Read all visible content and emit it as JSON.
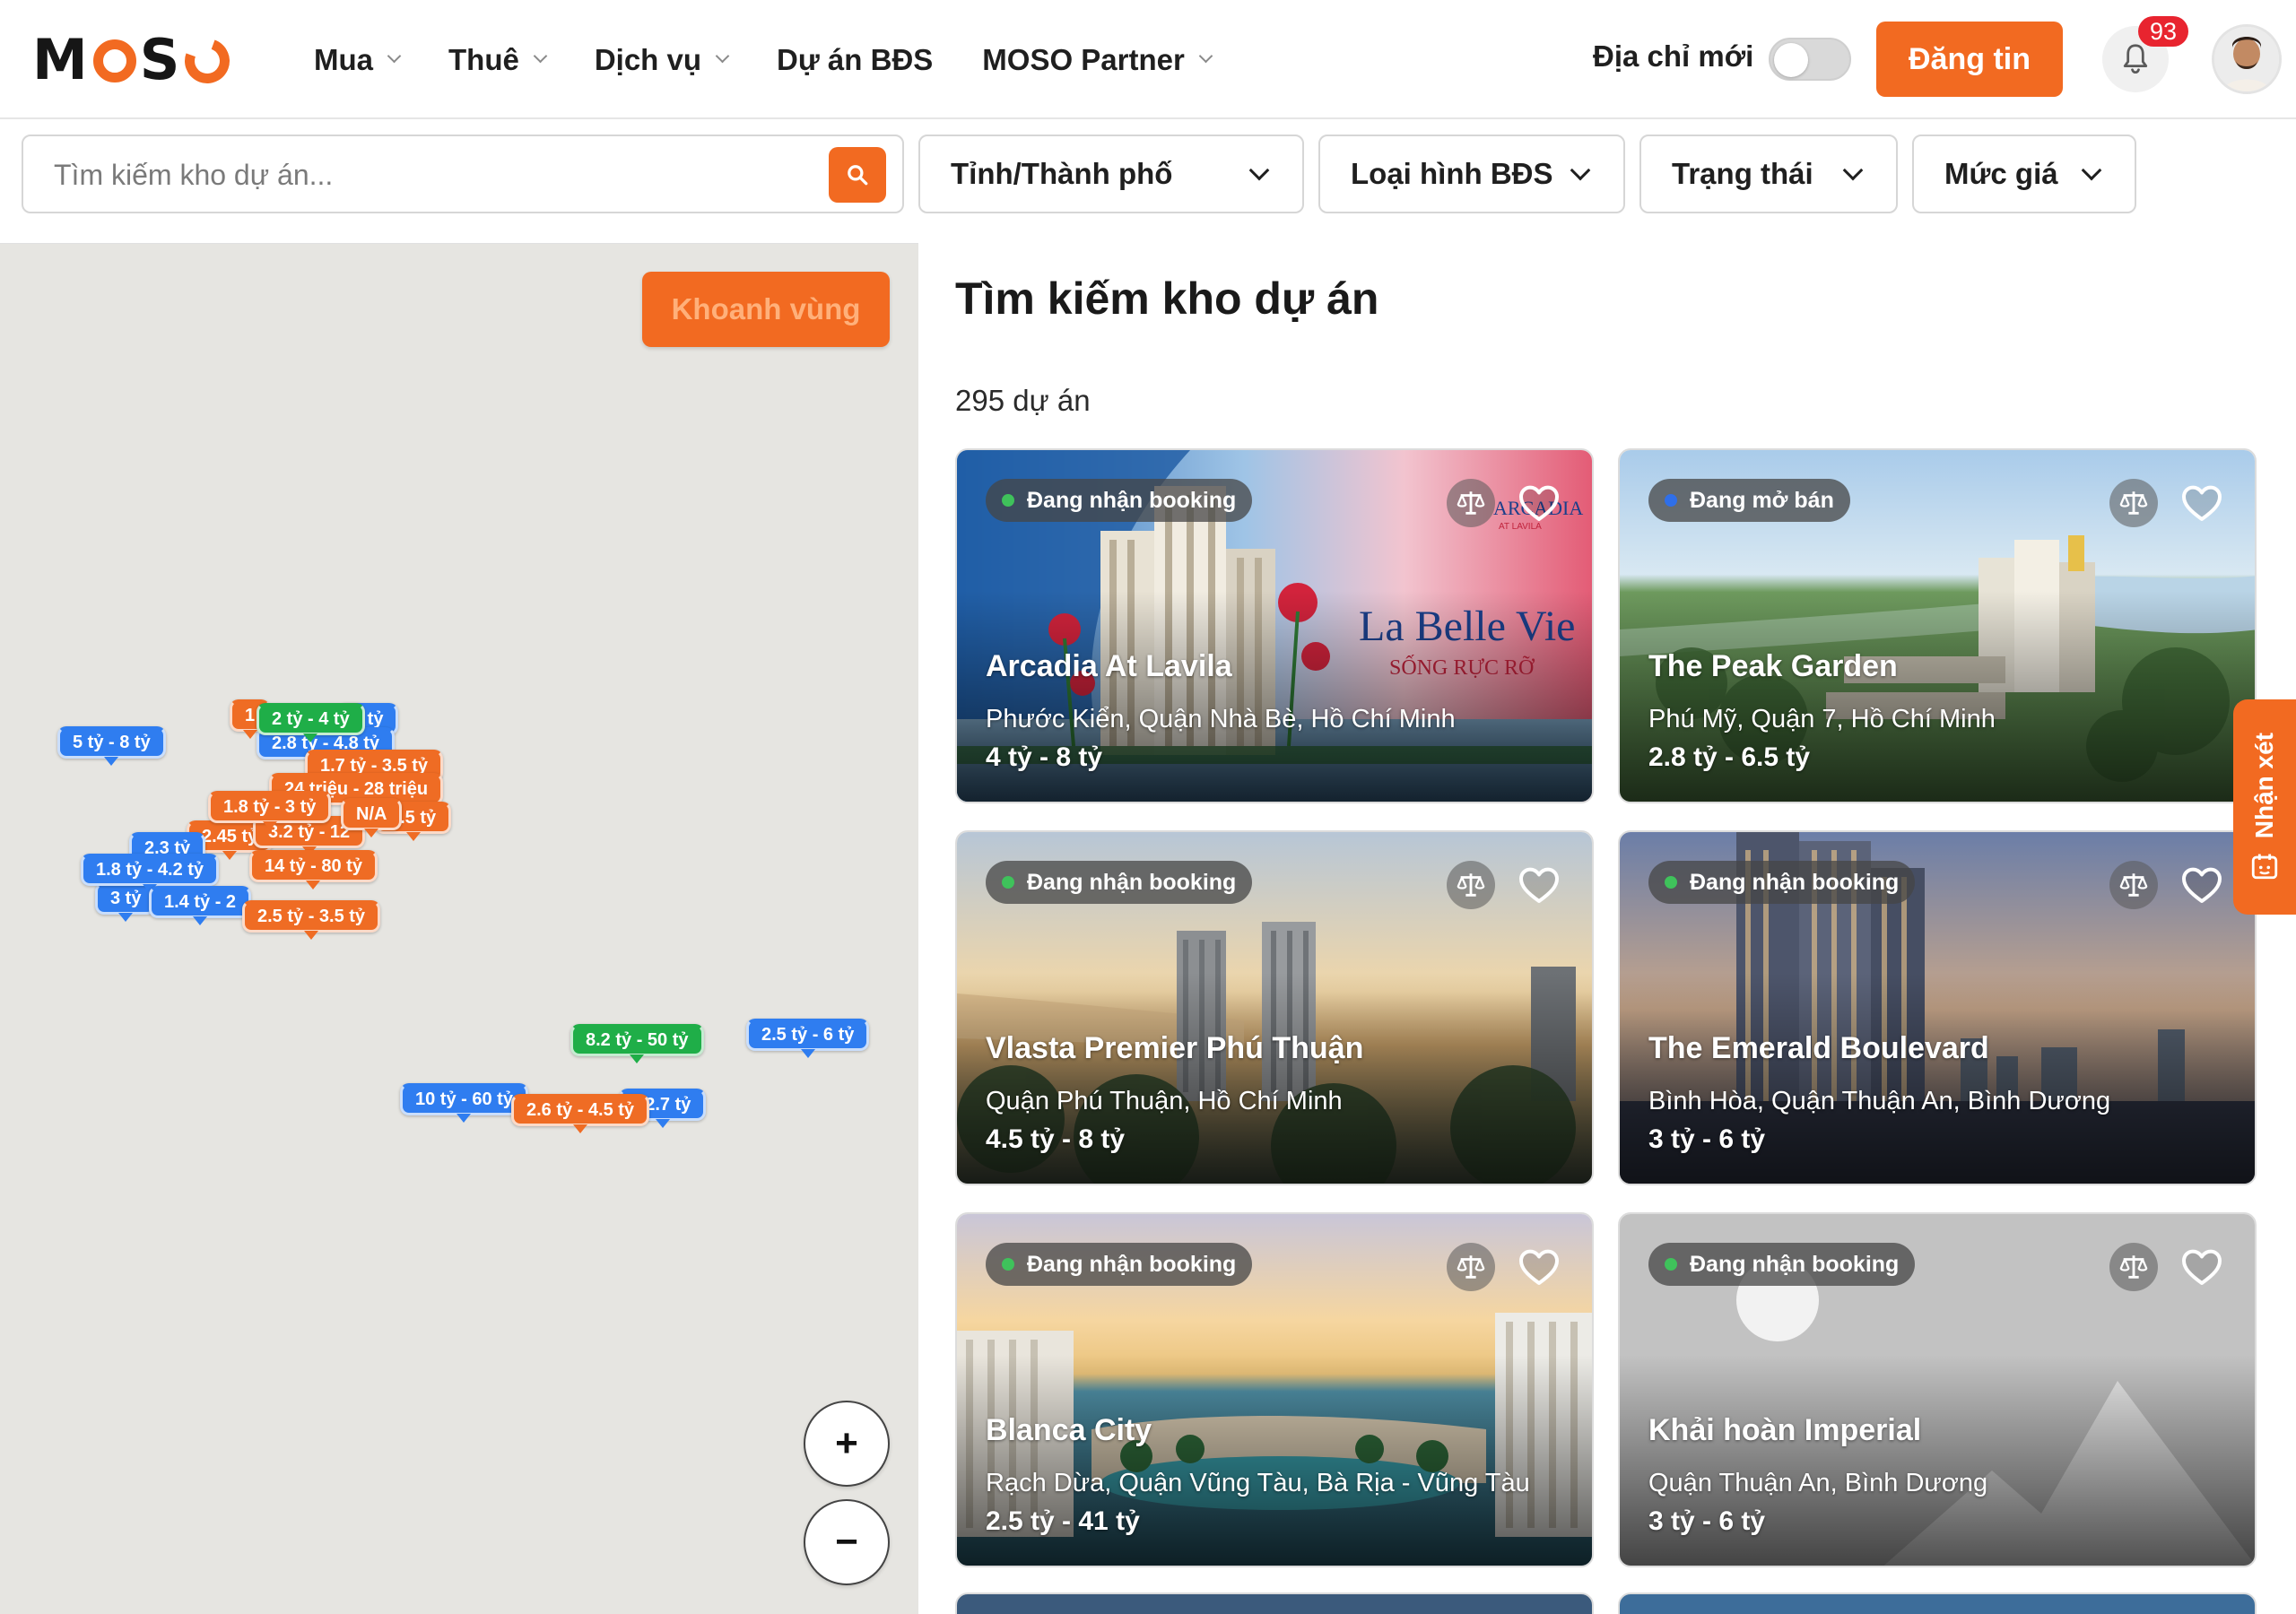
{
  "header": {
    "logo": "MOSO",
    "nav": [
      {
        "label": "Mua",
        "dropdown": true
      },
      {
        "label": "Thuê",
        "dropdown": true
      },
      {
        "label": "Dịch vụ",
        "dropdown": true
      },
      {
        "label": "Dự án BĐS",
        "dropdown": false
      },
      {
        "label": "MOSO Partner",
        "dropdown": true
      }
    ],
    "address_toggle_label": "Địa chỉ mới",
    "address_toggle_on": false,
    "post_button": "Đăng tin",
    "notification_count": "93",
    "accent_color": "#f26a21"
  },
  "filters": {
    "search_placeholder": "Tìm kiếm kho dự án...",
    "province": "Tỉnh/Thành phố",
    "property_type": "Loại hình BĐS",
    "status": "Trạng thái",
    "price": "Mức giá"
  },
  "map": {
    "zone_button": "Khoanh vùng",
    "zoom_in": "+",
    "zoom_out": "−",
    "pins": [
      {
        "label": "5 tỷ - 8 tỷ",
        "color": "blue"
      },
      {
        "label": "1",
        "color": "orange"
      },
      {
        "label": "2 tỷ - 4 tỷ",
        "color": "green"
      },
      {
        "label": "5 tỷ",
        "color": "blue"
      },
      {
        "label": "2.8 tỷ - 4.8 tỷ",
        "color": "blue"
      },
      {
        "label": "1.7 tỷ - 3.5 tỷ",
        "color": "orange"
      },
      {
        "label": "24 triệu - 28 triệu",
        "color": "orange"
      },
      {
        "label": "1.8 tỷ - 3 tỷ",
        "color": "orange"
      },
      {
        "label": "N/A",
        "color": "orange"
      },
      {
        "label": "5.5 tỷ",
        "color": "orange"
      },
      {
        "label": "3.2 tỷ - 12",
        "color": "orange"
      },
      {
        "label": "2.45 tỷ",
        "color": "orange"
      },
      {
        "label": "2.3 tỷ",
        "color": "blue"
      },
      {
        "label": "14 tỷ - 80 tỷ",
        "color": "orange"
      },
      {
        "label": "1.8 tỷ - 4.2 tỷ",
        "color": "blue"
      },
      {
        "label": "3 tỷ",
        "color": "blue"
      },
      {
        "label": "1.4 tỷ - 2",
        "color": "blue"
      },
      {
        "label": "2.5 tỷ - 3.5 tỷ",
        "color": "orange"
      },
      {
        "label": "8.2 tỷ - 50 tỷ",
        "color": "green"
      },
      {
        "label": "2.5 tỷ - 6 tỷ",
        "color": "blue"
      },
      {
        "label": "10 tỷ - 60 tỷ",
        "color": "blue"
      },
      {
        "label": "- 2.7 tỷ",
        "color": "blue"
      },
      {
        "label": "2.6 tỷ - 4.5 tỷ",
        "color": "orange"
      }
    ]
  },
  "results": {
    "title": "Tìm kiếm kho dự án",
    "count": "295 dự án",
    "projects": [
      {
        "status": "Đang nhận booking",
        "status_color": "#3fc25b",
        "name": "Arcadia At Lavila",
        "location": "Phước Kiển, Quận Nhà Bè, Hồ Chí Minh",
        "price": "4 tỷ - 8 tỷ",
        "art": "arcadia"
      },
      {
        "status": "Đang mở bán",
        "status_color": "#2f6fe8",
        "name": "The Peak Garden",
        "location": "Phú Mỹ, Quận 7, Hồ Chí Minh",
        "price": "2.8 tỷ - 6.5 tỷ",
        "art": "peak"
      },
      {
        "status": "Đang nhận booking",
        "status_color": "#3fc25b",
        "name": "Vlasta Premier Phú Thuận",
        "location": "Quận Phú Thuận, Hồ Chí Minh",
        "price": "4.5 tỷ - 8 tỷ",
        "art": "vlasta"
      },
      {
        "status": "Đang nhận booking",
        "status_color": "#3fc25b",
        "name": "The Emerald Boulevard",
        "location": "Bình Hòa, Quận Thuận An, Bình Dương",
        "price": "3 tỷ - 6 tỷ",
        "art": "emerald"
      },
      {
        "status": "Đang nhận booking",
        "status_color": "#3fc25b",
        "name": "Blanca City",
        "location": "Rạch Dừa, Quận Vũng Tàu, Bà Rịa - Vũng Tàu",
        "price": "2.5 tỷ - 41 tỷ",
        "art": "blanca"
      },
      {
        "status": "Đang nhận booking",
        "status_color": "#3fc25b",
        "name": "Khải hoàn Imperial",
        "location": "Quận Thuận An, Bình Dương",
        "price": "3 tỷ - 6 tỷ",
        "art": "placeholder"
      }
    ]
  },
  "arcadia_art": {
    "slogan": "La Belle Vie",
    "subslogan": "SỐNG RỰC RỠ",
    "brand": "ARCADIA",
    "brand_sub": "AT LAVILA"
  },
  "feedback_tab": "Nhận xét"
}
